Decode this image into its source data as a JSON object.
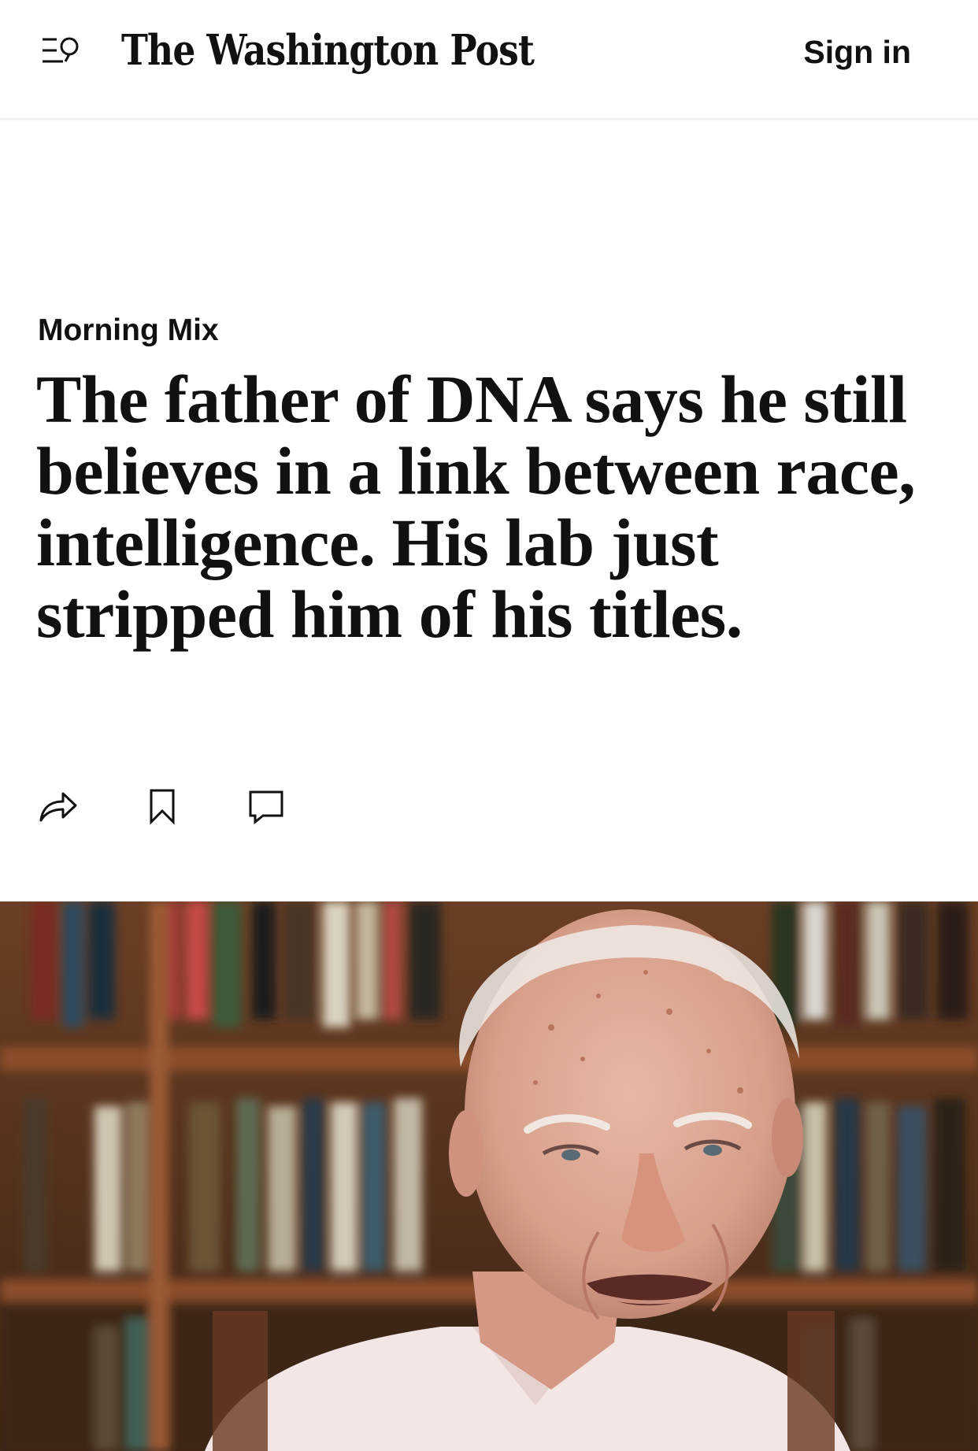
{
  "header": {
    "menu_search_icon": "menu-search-icon",
    "masthead": "The Washington Post",
    "sign_in_label": "Sign in"
  },
  "article": {
    "kicker": "Morning Mix",
    "headline": "The father of DNA says he still believes in a link between race, intelligence. His lab just stripped him of his titles.",
    "actions": [
      {
        "icon": "share-icon"
      },
      {
        "icon": "bookmark-icon"
      },
      {
        "icon": "comment-icon"
      }
    ]
  },
  "colors": {
    "text": "#111111",
    "background": "#ffffff",
    "photo_background": "#5a3a24",
    "shirt": "#f3e6e4"
  }
}
